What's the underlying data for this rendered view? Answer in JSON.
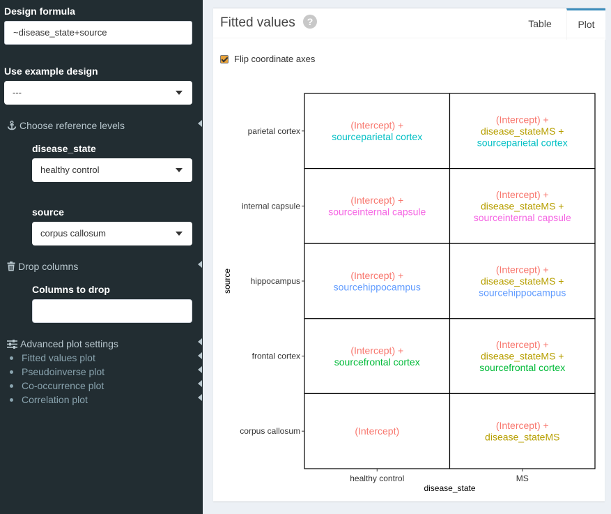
{
  "sidebar": {
    "design_formula_label": "Design formula",
    "design_formula_value": "~disease_state+source",
    "example_design_label": "Use example design",
    "example_design_value": "---",
    "ref_levels_label": "Choose reference levels",
    "disease_state_label": "disease_state",
    "disease_state_value": "healthy control",
    "source_label": "source",
    "source_value": "corpus callosum",
    "drop_columns_label": "Drop columns",
    "columns_to_drop_label": "Columns to drop",
    "columns_to_drop_value": "",
    "advanced_label": "Advanced plot settings",
    "advanced_items": [
      "Fitted values plot",
      "Pseudoinverse plot",
      "Co-occurrence plot",
      "Correlation plot"
    ]
  },
  "main": {
    "title": "Fitted values",
    "help_glyph": "?",
    "tabs": [
      {
        "label": "Table",
        "active": false
      },
      {
        "label": "Plot",
        "active": true
      }
    ],
    "flip_label": "Flip coordinate axes",
    "flip_checked": true
  },
  "colors": {
    "intercept": "#f8766d",
    "disease_stateMS": "#b79f00",
    "sourceparietal cortex": "#00bfc4",
    "sourceinternal capsule": "#f564e3",
    "sourcehippocampus": "#619cff",
    "sourcefrontal cortex": "#00ba38"
  },
  "chart_data": {
    "type": "table",
    "xlabel": "disease_state",
    "ylabel": "source",
    "x_categories": [
      "healthy control",
      "MS"
    ],
    "y_categories": [
      "parietal cortex",
      "internal capsule",
      "hippocampus",
      "frontal cortex",
      "corpus callosum"
    ],
    "cells": [
      [
        [
          "(Intercept) +",
          "sourceparietal cortex"
        ],
        [
          "(Intercept) +",
          "disease_stateMS +",
          "sourceparietal cortex"
        ]
      ],
      [
        [
          "(Intercept) +",
          "sourceinternal capsule"
        ],
        [
          "(Intercept) +",
          "disease_stateMS +",
          "sourceinternal capsule"
        ]
      ],
      [
        [
          "(Intercept) +",
          "sourcehippocampus"
        ],
        [
          "(Intercept) +",
          "disease_stateMS +",
          "sourcehippocampus"
        ]
      ],
      [
        [
          "(Intercept) +",
          "sourcefrontal cortex"
        ],
        [
          "(Intercept) +",
          "disease_stateMS +",
          "sourcefrontal cortex"
        ]
      ],
      [
        [
          "(Intercept)"
        ],
        [
          "(Intercept) +",
          "disease_stateMS"
        ]
      ]
    ]
  }
}
